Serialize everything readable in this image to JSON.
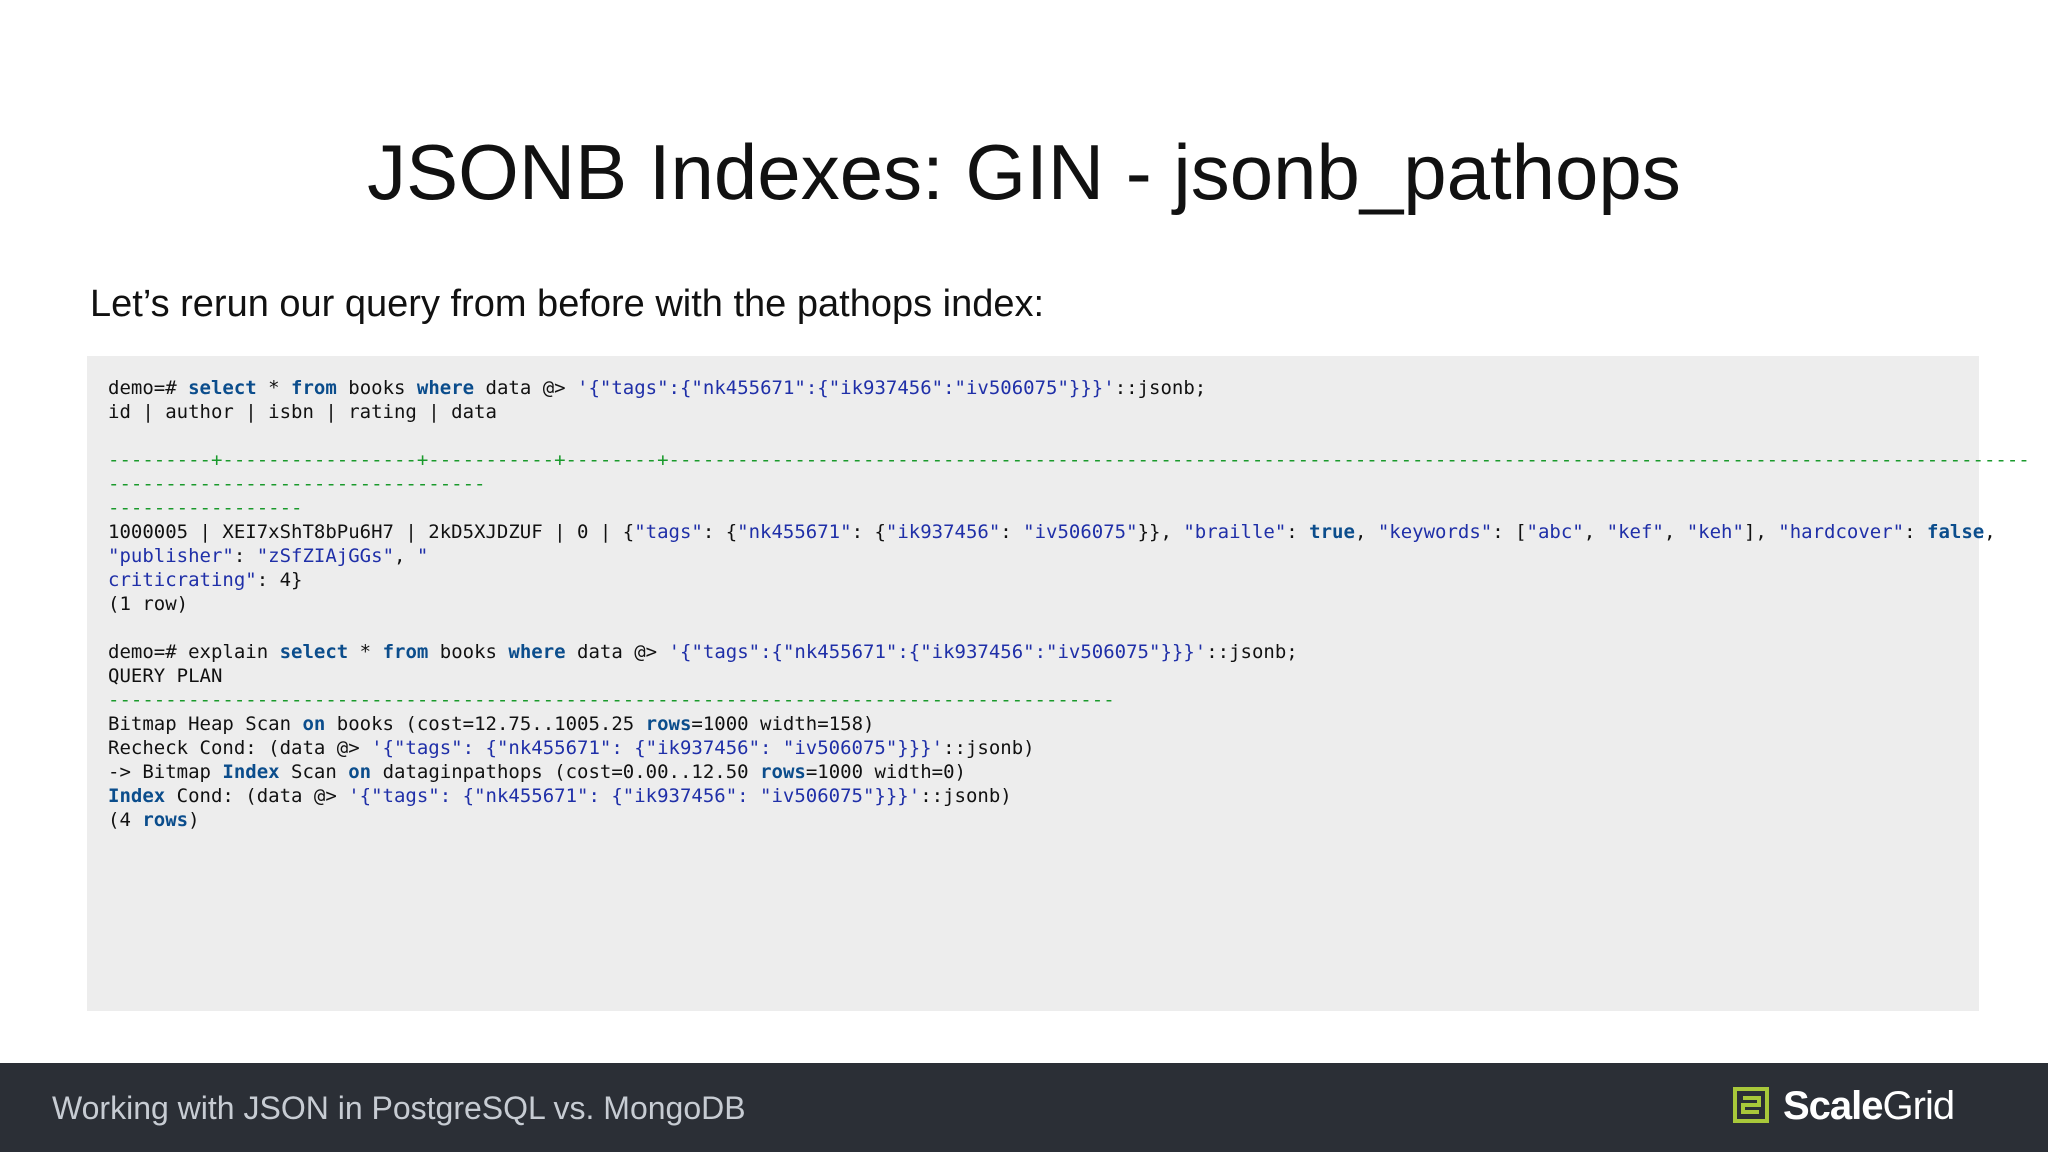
{
  "slide": {
    "title": "JSONB Indexes: GIN - jsonb_pathops",
    "intro": "Let’s rerun our query from before with the pathops index:"
  },
  "code": {
    "lines": [
      [
        {
          "t": "demo=# "
        },
        {
          "t": "select",
          "c": "kw"
        },
        {
          "t": " * "
        },
        {
          "t": "from",
          "c": "kw"
        },
        {
          "t": " books "
        },
        {
          "t": "where",
          "c": "kw"
        },
        {
          "t": " data @> "
        },
        {
          "t": "'{\"tags\":{\"nk455671\":{\"ik937456\":\"iv506075\"}}}'",
          "c": "str"
        },
        {
          "t": "::jsonb;"
        }
      ],
      [
        {
          "t": "id | author | isbn | rating | data"
        }
      ],
      [
        {
          "t": ""
        }
      ],
      [
        {
          "t": "---------+-----------------+-----------+--------+-----------------------------------------------------------------------------------------------------------------------",
          "c": "sep"
        }
      ],
      [
        {
          "t": "---------------------------------",
          "c": "sep"
        }
      ],
      [
        {
          "t": "-----------------",
          "c": "sep"
        }
      ],
      [
        {
          "t": "1000005 | XEI7xShT8bPu6H7 | 2kD5XJDZUF | 0 | {"
        },
        {
          "t": "\"tags\"",
          "c": "str"
        },
        {
          "t": ": {"
        },
        {
          "t": "\"nk455671\"",
          "c": "str"
        },
        {
          "t": ": {"
        },
        {
          "t": "\"ik937456\"",
          "c": "str"
        },
        {
          "t": ": "
        },
        {
          "t": "\"iv506075\"",
          "c": "str"
        },
        {
          "t": "}}, "
        },
        {
          "t": "\"braille\"",
          "c": "str"
        },
        {
          "t": ": "
        },
        {
          "t": "true",
          "c": "kw"
        },
        {
          "t": ", "
        },
        {
          "t": "\"keywords\"",
          "c": "str"
        },
        {
          "t": ": ["
        },
        {
          "t": "\"abc\"",
          "c": "str"
        },
        {
          "t": ", "
        },
        {
          "t": "\"kef\"",
          "c": "str"
        },
        {
          "t": ", "
        },
        {
          "t": "\"keh\"",
          "c": "str"
        },
        {
          "t": "], "
        },
        {
          "t": "\"hardcover\"",
          "c": "str"
        },
        {
          "t": ": "
        },
        {
          "t": "false",
          "c": "kw"
        },
        {
          "t": ","
        }
      ],
      [
        {
          "t": "\"publisher\"",
          "c": "str"
        },
        {
          "t": ": "
        },
        {
          "t": "\"zSfZIAjGGs\"",
          "c": "str"
        },
        {
          "t": ", "
        },
        {
          "t": "\"",
          "c": "str"
        }
      ],
      [
        {
          "t": "criticrating\"",
          "c": "str"
        },
        {
          "t": ": 4}"
        }
      ],
      [
        {
          "t": "(1 row)"
        }
      ],
      [
        {
          "t": ""
        }
      ],
      [
        {
          "t": "demo=# explain "
        },
        {
          "t": "select",
          "c": "kw"
        },
        {
          "t": " * "
        },
        {
          "t": "from",
          "c": "kw"
        },
        {
          "t": " books "
        },
        {
          "t": "where",
          "c": "kw"
        },
        {
          "t": " data @> "
        },
        {
          "t": "'{\"tags\":{\"nk455671\":{\"ik937456\":\"iv506075\"}}}'",
          "c": "str"
        },
        {
          "t": "::jsonb;"
        }
      ],
      [
        {
          "t": "QUERY PLAN"
        }
      ],
      [
        {
          "t": "----------------------------------------------------------------------------------------",
          "c": "sep"
        }
      ],
      [
        {
          "t": "Bitmap Heap Scan "
        },
        {
          "t": "on",
          "c": "kw"
        },
        {
          "t": " books (cost=12.75..1005.25 "
        },
        {
          "t": "rows",
          "c": "kw"
        },
        {
          "t": "=1000 width=158)"
        }
      ],
      [
        {
          "t": "Recheck Cond: (data @> "
        },
        {
          "t": "'{\"tags\": {\"nk455671\": {\"ik937456\": \"iv506075\"}}}'",
          "c": "str"
        },
        {
          "t": "::jsonb)"
        }
      ],
      [
        {
          "t": "-> Bitmap "
        },
        {
          "t": "Index",
          "c": "kw"
        },
        {
          "t": " Scan "
        },
        {
          "t": "on",
          "c": "kw"
        },
        {
          "t": " dataginpathops (cost=0.00..12.50 "
        },
        {
          "t": "rows",
          "c": "kw"
        },
        {
          "t": "=1000 width=0)"
        }
      ],
      [
        {
          "t": "Index",
          "c": "kw"
        },
        {
          "t": " Cond: (data @> "
        },
        {
          "t": "'{\"tags\": {\"nk455671\": {\"ik937456\": \"iv506075\"}}}'",
          "c": "str"
        },
        {
          "t": "::jsonb)"
        }
      ],
      [
        {
          "t": "(4 "
        },
        {
          "t": "rows",
          "c": "kw"
        },
        {
          "t": ")"
        }
      ]
    ]
  },
  "footer": {
    "caption": "Working with JSON in PostgreSQL vs. MongoDB",
    "logo_icon": "scalegrid-logo-icon",
    "logo_part1": "Scale",
    "logo_part2": "Grid"
  },
  "colors": {
    "footer_bg": "#2b2f36",
    "code_bg": "#ededed",
    "keyword": "#0b4d8c",
    "string": "#1f2fa8",
    "separator": "#1a9a2c",
    "logo_accent": "#a8c83a"
  }
}
